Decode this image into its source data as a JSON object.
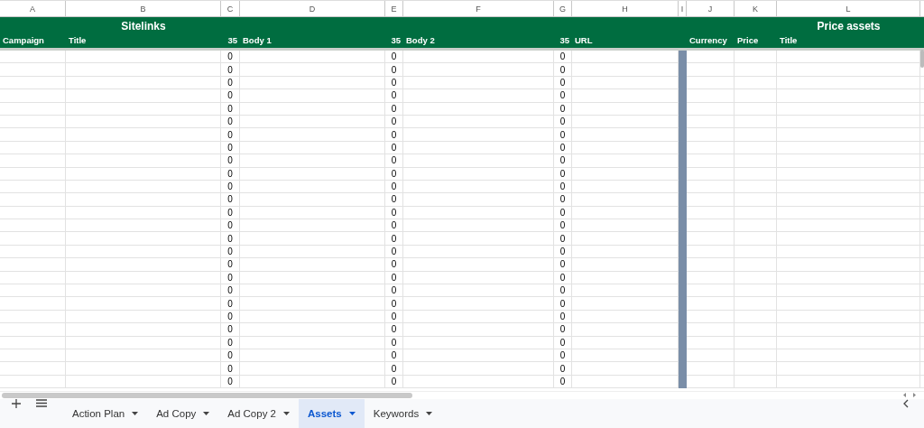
{
  "columns": [
    {
      "letter": "A",
      "label": "Campaign",
      "kind": "text"
    },
    {
      "letter": "B",
      "group": "Sitelinks",
      "label": "Title",
      "kind": "text"
    },
    {
      "letter": "C",
      "label": "35",
      "kind": "count"
    },
    {
      "letter": "D",
      "label": "Body 1",
      "kind": "text"
    },
    {
      "letter": "E",
      "label": "35",
      "kind": "count"
    },
    {
      "letter": "F",
      "label": "Body 2",
      "kind": "text"
    },
    {
      "letter": "G",
      "label": "35",
      "kind": "count"
    },
    {
      "letter": "H",
      "label": "URL",
      "kind": "text"
    },
    {
      "letter": "I",
      "kind": "divider"
    },
    {
      "letter": "J",
      "label": "Currency",
      "kind": "text"
    },
    {
      "letter": "K",
      "label": "Price",
      "kind": "text"
    },
    {
      "letter": "L",
      "group": "Price assets",
      "label": "Title",
      "kind": "text"
    }
  ],
  "rows": [
    [
      "0",
      "0",
      "0"
    ],
    [
      "0",
      "0",
      "0"
    ],
    [
      "0",
      "0",
      "0"
    ],
    [
      "0",
      "0",
      "0"
    ],
    [
      "0",
      "0",
      "0"
    ],
    [
      "0",
      "0",
      "0"
    ],
    [
      "0",
      "0",
      "0"
    ],
    [
      "0",
      "0",
      "0"
    ],
    [
      "0",
      "0",
      "0"
    ],
    [
      "0",
      "0",
      "0"
    ],
    [
      "0",
      "0",
      "0"
    ],
    [
      "0",
      "0",
      "0"
    ],
    [
      "0",
      "0",
      "0"
    ],
    [
      "0",
      "0",
      "0"
    ],
    [
      "0",
      "0",
      "0"
    ],
    [
      "0",
      "0",
      "0"
    ],
    [
      "0",
      "0",
      "0"
    ],
    [
      "0",
      "0",
      "0"
    ],
    [
      "0",
      "0",
      "0"
    ],
    [
      "0",
      "0",
      "0"
    ],
    [
      "0",
      "0",
      "0"
    ],
    [
      "0",
      "0",
      "0"
    ],
    [
      "0",
      "0",
      "0"
    ],
    [
      "0",
      "0",
      "0"
    ],
    [
      "0",
      "0",
      "0"
    ],
    [
      "0",
      "0",
      "0"
    ]
  ],
  "sheet_tabs": [
    {
      "label": "Action Plan",
      "selected": false
    },
    {
      "label": "Ad Copy",
      "selected": false
    },
    {
      "label": "Ad Copy 2",
      "selected": false
    },
    {
      "label": "Assets",
      "selected": true
    },
    {
      "label": "Keywords",
      "selected": false
    }
  ]
}
